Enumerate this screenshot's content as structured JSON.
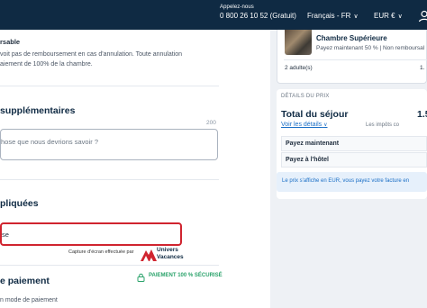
{
  "header": {
    "call_label": "Appelez-nous",
    "phone": "0 800 26 10 52 (Gratuit)",
    "language": "Français - FR",
    "currency": "EUR €"
  },
  "booking": {
    "policy_title": "rsable",
    "policy_text": [
      "voit pas de remboursement en cas d'annulation. Toute annulation",
      "aiement de 100% de la chambre."
    ],
    "requests_title": "supplémentaires",
    "requests_counter": "200",
    "requests_placeholder": "hose que nous devrions savoir ?",
    "applied_title": "pliquées",
    "applied_input_value": "se",
    "capture_text": "Capture d'écran effectuée par",
    "capture_brand_line1": "Univers",
    "capture_brand_line2": "Vacances",
    "payment_title": "e paiement",
    "secure_label": "PAIEMENT 100 % SÉCURISÉ",
    "payment_sub": "n mode de paiement"
  },
  "summary": {
    "room_name": "Chambre Supérieure",
    "room_terms": "Payez maintenant 50 % | Non remboursal",
    "adults": "2 adulte(s)",
    "adults_price": "1.",
    "price_details_label": "DÉTAILS DU PRIX",
    "total_label": "Total du séjour",
    "total_amount": "1.5",
    "details_link": "Voir les détails",
    "taxes_note": "Les impôts co",
    "pay_now_label": "Payez maintenant",
    "pay_hotel_label": "Payez à l'hôtel",
    "currency_note": "Le prix s'affiche en EUR, vous payez votre facture en"
  },
  "colors": {
    "header_bg": "#0f2a43",
    "link": "#1b6fc6",
    "error_border": "#d0242f",
    "secure_green": "#2ba36b"
  },
  "icons": [
    "chevron-down-icon",
    "user-icon",
    "lock-icon",
    "univers-vacances-logo"
  ]
}
